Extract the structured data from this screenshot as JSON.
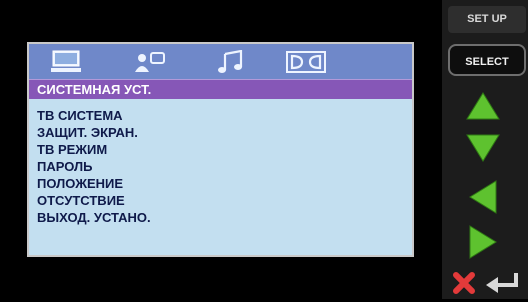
{
  "osd": {
    "tabs": [
      {
        "icon": "monitor-icon"
      },
      {
        "icon": "speaker-person-icon"
      },
      {
        "icon": "music-note-icon"
      },
      {
        "icon": "dolby-icon"
      }
    ],
    "title": "СИСТЕМНАЯ УСТ.",
    "items": [
      "ТВ СИСТЕМА",
      "ЗАЩИТ. ЭКРАН.",
      "ТВ РЕЖИМ",
      "ПАРОЛЬ",
      "ПОЛОЖЕНИЕ",
      "ОТСУТСТВИЕ",
      "ВЫХОД. УСТАНО."
    ]
  },
  "panel": {
    "setup_label": "SET UP",
    "select_label": "SELECT",
    "nav": [
      "up-arrow-icon",
      "down-arrow-icon",
      "left-arrow-icon",
      "right-arrow-icon"
    ],
    "close_icon": "close-icon",
    "return_icon": "return-icon"
  },
  "colors": {
    "tab_bar": "#6f88c9",
    "title_bar": "#8657b7",
    "menu_bg": "#c3dff0",
    "menu_text": "#0f1a4a",
    "arrow_green": "#5ec22f",
    "close_red": "#e33a3a"
  }
}
